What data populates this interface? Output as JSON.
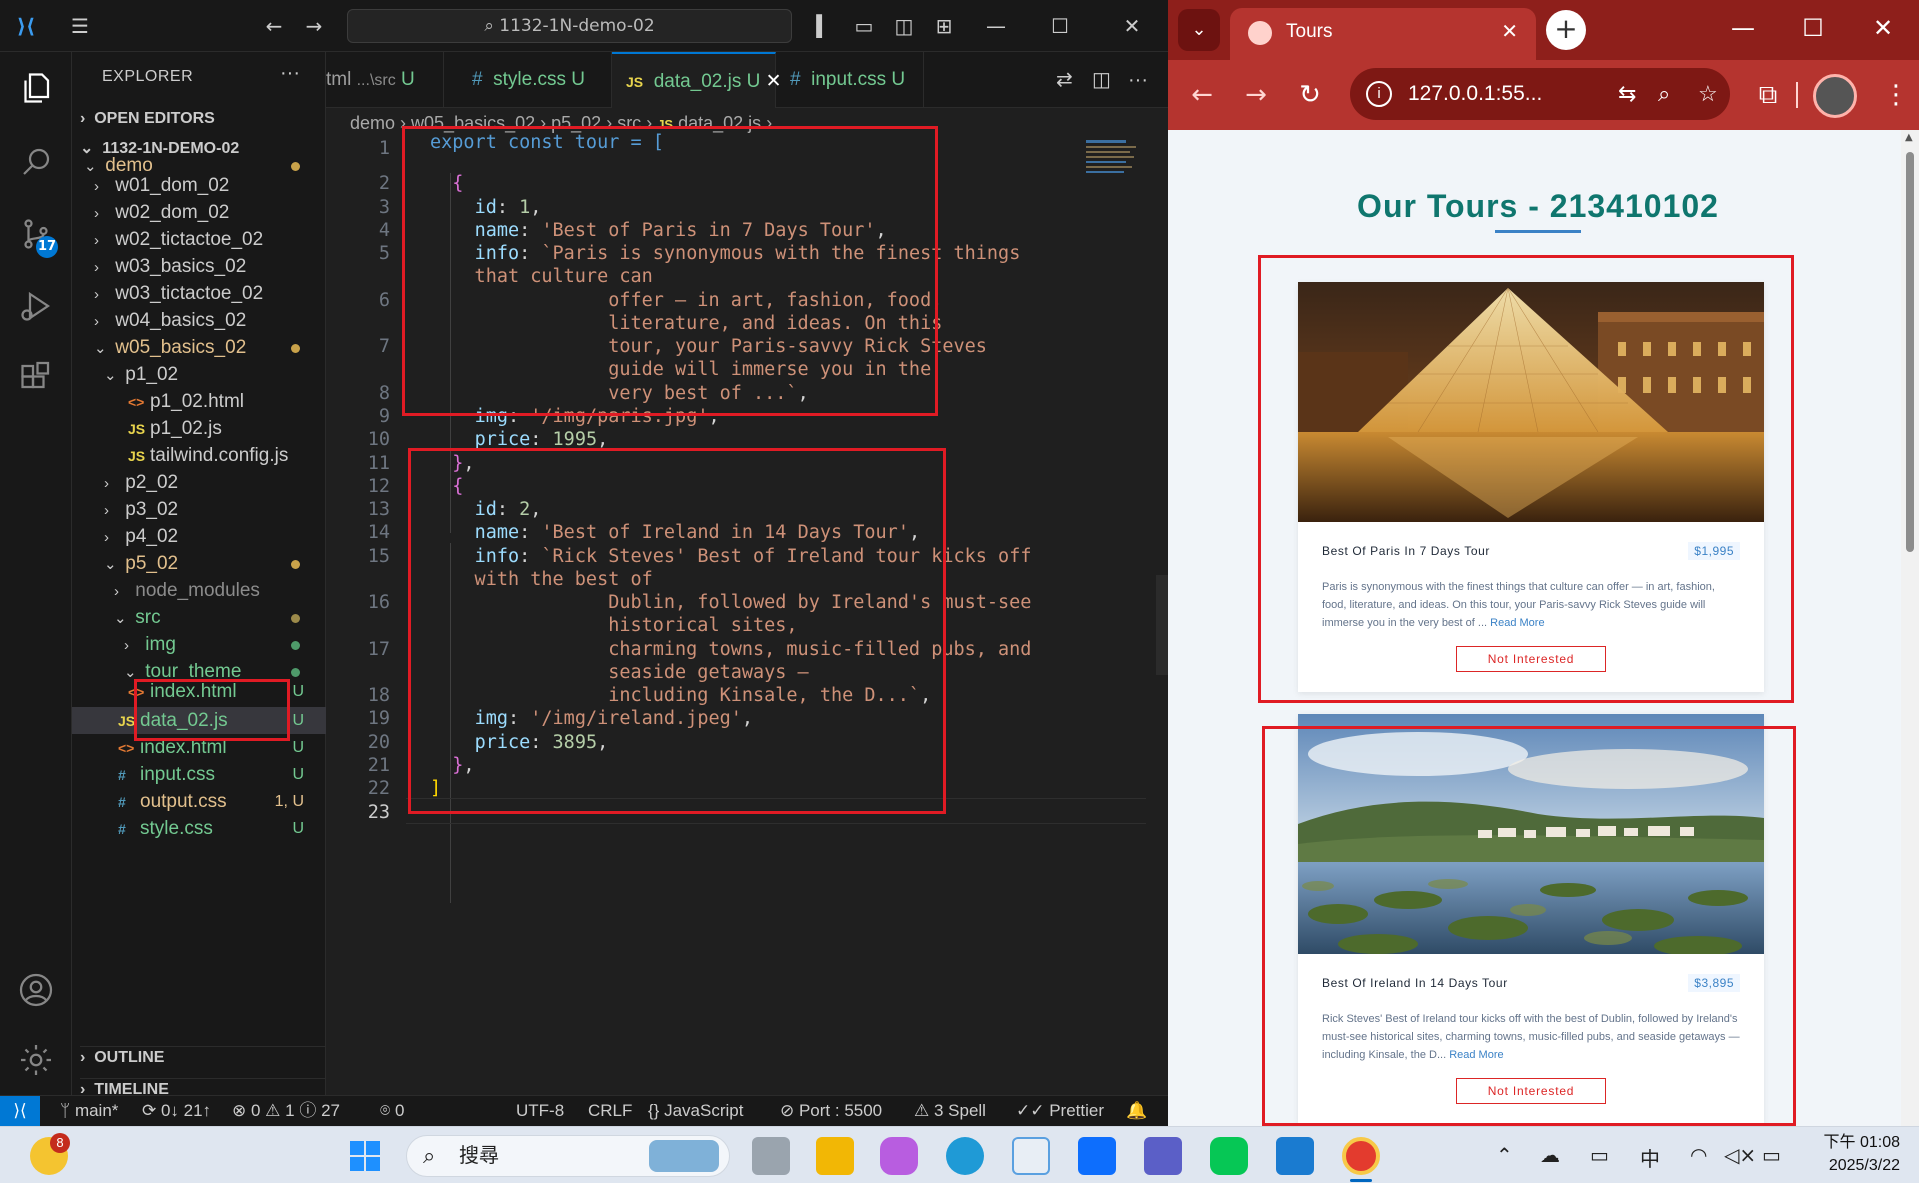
{
  "vscode": {
    "title": "1132-1N-demo-02",
    "sidebar": {
      "title": "EXPLORER",
      "sections": {
        "open_editors": "OPEN EDITORS",
        "root": "1132-1N-DEMO-02",
        "outline": "OUTLINE",
        "timeline": "TIMELINE"
      },
      "tree": [
        {
          "label": "demo",
          "status": ""
        },
        {
          "label": "w01_dom_02",
          "status": ""
        },
        {
          "label": "w02_dom_02",
          "status": ""
        },
        {
          "label": "w02_tictactoe_02",
          "status": ""
        },
        {
          "label": "w03_basics_02",
          "status": ""
        },
        {
          "label": "w03_tictactoe_02",
          "status": ""
        },
        {
          "label": "w04_basics_02",
          "status": ""
        },
        {
          "label": "w05_basics_02",
          "status": ""
        },
        {
          "label": "p1_02",
          "status": ""
        },
        {
          "label": "p1_02.html",
          "status": ""
        },
        {
          "label": "p1_02.js",
          "status": ""
        },
        {
          "label": "tailwind.config.js",
          "status": ""
        },
        {
          "label": "p2_02",
          "status": ""
        },
        {
          "label": "p3_02",
          "status": ""
        },
        {
          "label": "p4_02",
          "status": ""
        },
        {
          "label": "p5_02",
          "status": ""
        },
        {
          "label": "node_modules",
          "status": ""
        },
        {
          "label": "src",
          "status": ""
        },
        {
          "label": "img",
          "status": ""
        },
        {
          "label": "tour_theme",
          "status": ""
        },
        {
          "label": "index.html",
          "status": "U"
        },
        {
          "label": "data_02.js",
          "status": "U"
        },
        {
          "label": "index.html",
          "status": "U"
        },
        {
          "label": "input.css",
          "status": "U"
        },
        {
          "label": "output.css",
          "status": "1, U"
        },
        {
          "label": "style.css",
          "status": "U"
        }
      ]
    },
    "tabs": [
      {
        "label": "tml",
        "desc": "...\\src",
        "status": "U"
      },
      {
        "label": "style.css",
        "status": "U"
      },
      {
        "label": "data_02.js",
        "status": "U"
      },
      {
        "label": "input.css",
        "status": "U"
      }
    ],
    "breadcrumb": [
      "demo",
      "w05_basics_02",
      "p5_02",
      "src",
      "data_02.js",
      "..."
    ],
    "activity_badge": "17",
    "status_bar": {
      "branch": "main*",
      "sync": "0↓ 21↑",
      "problems": "0",
      "warnings": "1",
      "infos": "27",
      "ports_count": "0",
      "encoding": "UTF-8",
      "eol": "CRLF",
      "language": "JavaScript",
      "port": "Port : 5500",
      "spell": "3 Spell",
      "formatter": "Prettier"
    }
  },
  "browser": {
    "tab_title": "Tours",
    "url": "127.0.0.1:55...",
    "page_title": "Our Tours - 213410102",
    "tours": [
      {
        "name": "Best Of Paris In 7 Days Tour",
        "price": "$1,995",
        "info": "Paris is synonymous with the finest things that culture can offer — in art, fashion, food, literature, and ideas. On this tour, your Paris-savvy Rick Steves guide will immerse you in the very best of ...",
        "read_more": "Read More",
        "button": "Not Interested"
      },
      {
        "name": "Best Of Ireland In 14 Days Tour",
        "price": "$3,895",
        "info": "Rick Steves' Best of Ireland tour kicks off with the best of Dublin, followed by Ireland's must-see historical sites, charming towns, music-filled pubs, and seaside getaways — including Kinsale, the D...",
        "read_more": "Read More",
        "button": "Not Interested"
      }
    ]
  },
  "taskbar": {
    "weather_badge": "8",
    "search_placeholder": "搜尋",
    "time": "下午 01:08",
    "date": "2025/3/22",
    "ime": "中"
  },
  "colors": {
    "accent": "#0078d4",
    "chrome": "#b5342f",
    "title": "#0f766e",
    "danger": "#dc2626"
  }
}
